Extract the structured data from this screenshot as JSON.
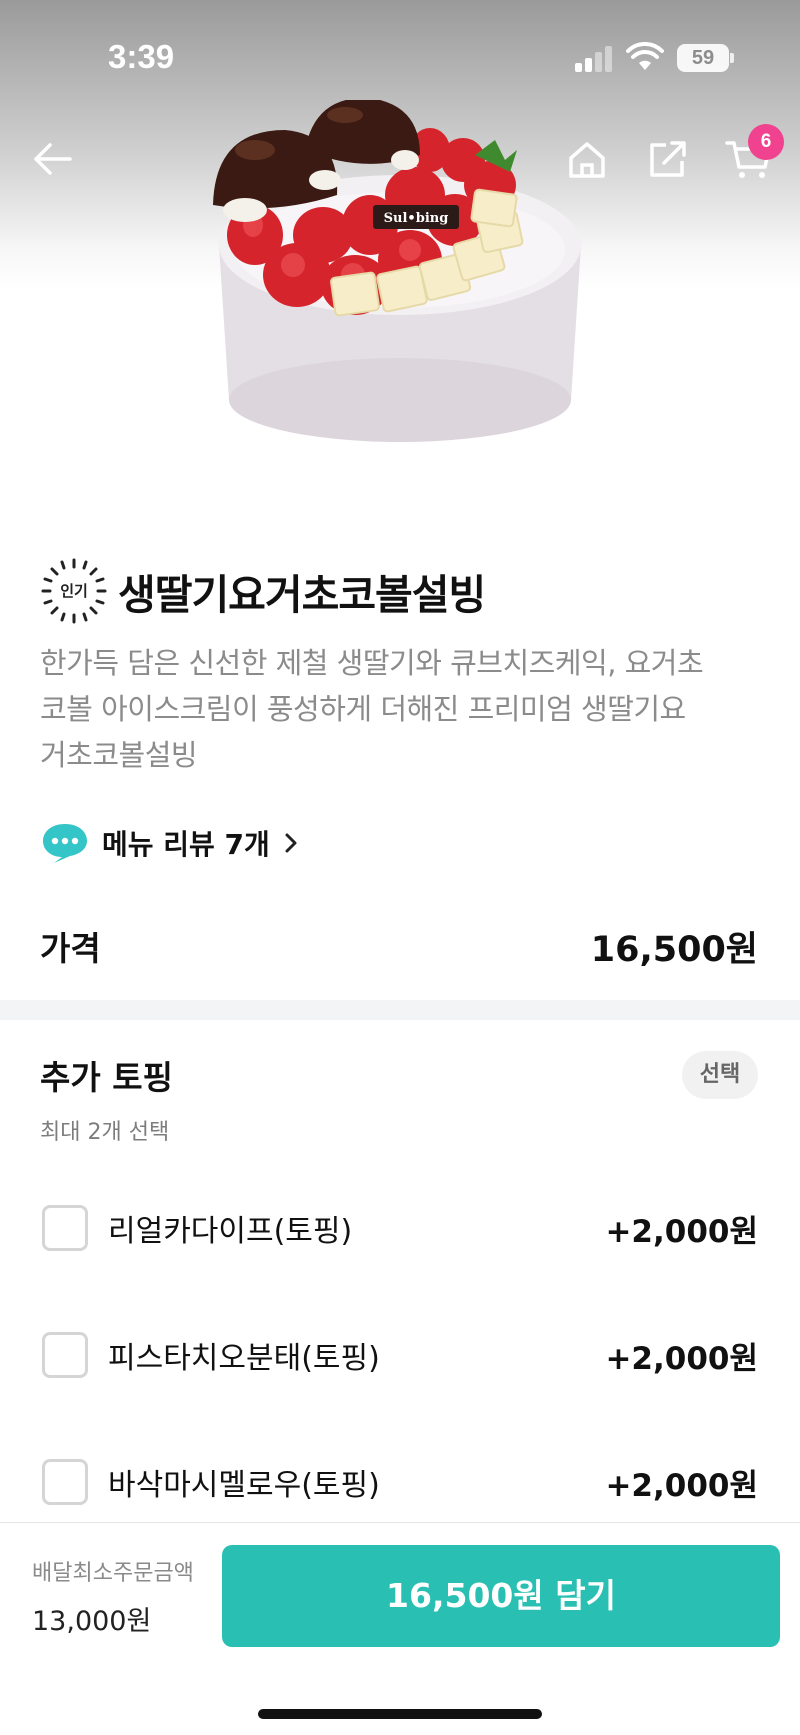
{
  "status_bar": {
    "time": "3:39",
    "battery": "59"
  },
  "nav": {
    "icons": [
      "back-arrow-icon",
      "home-icon",
      "share-icon",
      "cart-icon"
    ],
    "cart_count": "6"
  },
  "product": {
    "image": "strawberry-yogurt-choco-bingsu-image",
    "image_brand_text": "Sul•bing",
    "badge": "인기",
    "name": "생딸기요거초코볼설빙",
    "description_lines": [
      "한가득 담은 신선한 제철 생딸기와 큐브치즈케익, 요거초",
      "코볼 아이스크림이 풍성하게 더해진 프리미엄 생딸기요",
      "거초코볼설빙"
    ],
    "review_label": "메뉴 리뷰 7개",
    "price_label": "가격",
    "price_value": "16,500원"
  },
  "toppings": {
    "title": "추가 토핑",
    "select_label": "선택",
    "subtitle": "최대 2개 선택",
    "options": [
      {
        "label": "리얼카다이프(토핑)",
        "price": "+2,000원",
        "checked": false
      },
      {
        "label": "피스타치오분태(토핑)",
        "price": "+2,000원",
        "checked": false
      },
      {
        "label": "바삭마시멜로우(토핑)",
        "price": "+2,000원",
        "checked": false
      }
    ]
  },
  "bottom_bar": {
    "min_order_label": "배달최소주문금액",
    "min_order_value": "13,000원",
    "add_button": "16,500원 담기"
  },
  "colors": {
    "accent": "#29c0b3",
    "badge": "#f0428f",
    "chat_icon": "#33c5c7"
  }
}
